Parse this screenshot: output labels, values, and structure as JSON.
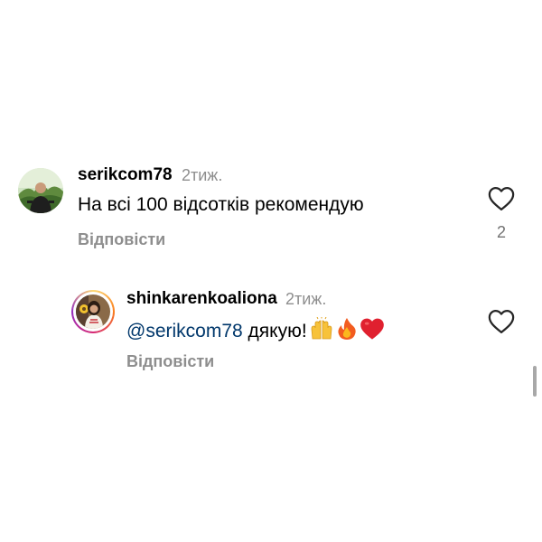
{
  "comments": [
    {
      "username": "serikcom78",
      "timestamp": "2тиж.",
      "text": "На всі 100 відсотків рекомендую",
      "reply_label": "Відповісти",
      "like_count": "2",
      "avatar_icon": "avatar-photo-man"
    }
  ],
  "replies": [
    {
      "username": "shinkarenkoaliona",
      "timestamp": "2тиж.",
      "mention": "@serikcom78",
      "text": " дякую!",
      "emojis": [
        "raising-hands-icon",
        "fire-icon",
        "red-heart-icon"
      ],
      "reply_label": "Відповісти",
      "avatar_icon": "avatar-photo-woman",
      "avatar_ring_colors": [
        "#feda75",
        "#fa7e1e",
        "#d62976",
        "#962fbf"
      ]
    }
  ],
  "colors": {
    "secondary_text": "#8e8e8e",
    "mention": "#00376b",
    "heart_emoji": "#e0202f"
  }
}
